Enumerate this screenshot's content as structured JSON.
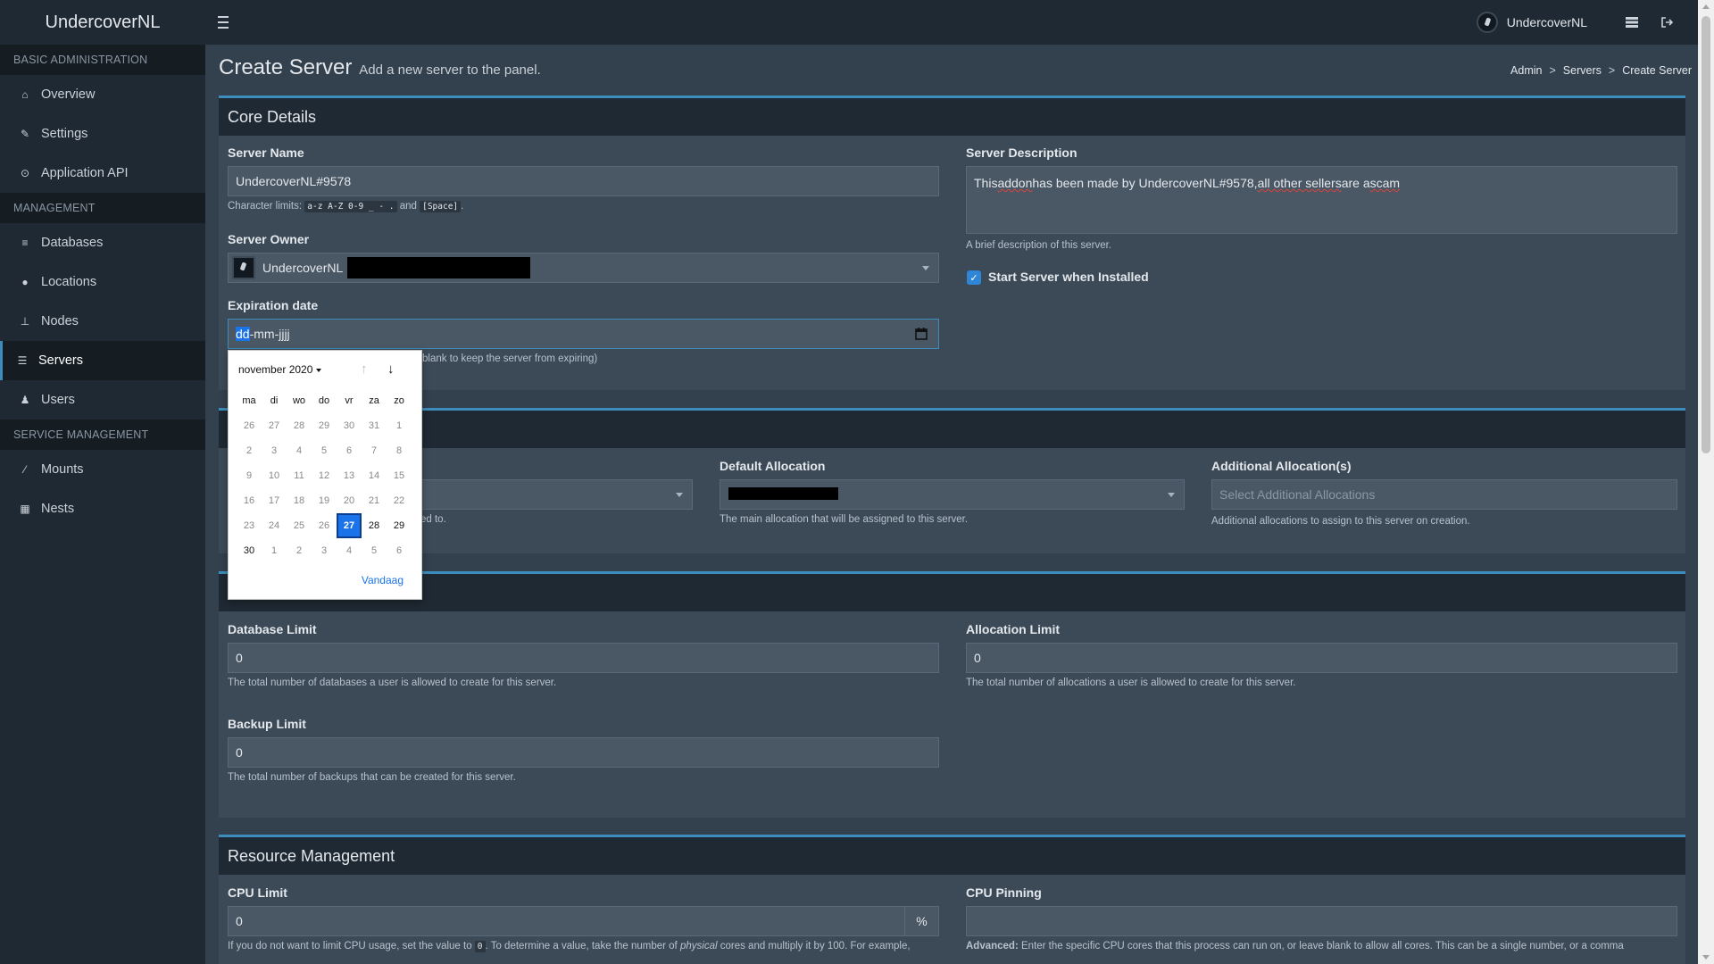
{
  "header": {
    "brand": "UndercoverNL",
    "user_name": "UndercoverNL"
  },
  "sidebar": {
    "sections": [
      {
        "title": "BASIC ADMINISTRATION",
        "items": [
          {
            "label": "Overview",
            "icon": "home-icon"
          },
          {
            "label": "Settings",
            "icon": "wrench-icon"
          },
          {
            "label": "Application API",
            "icon": "gamepad-icon"
          }
        ]
      },
      {
        "title": "MANAGEMENT",
        "items": [
          {
            "label": "Databases",
            "icon": "database-icon"
          },
          {
            "label": "Locations",
            "icon": "globe-icon"
          },
          {
            "label": "Nodes",
            "icon": "sitemap-icon"
          },
          {
            "label": "Servers",
            "icon": "server-icon",
            "active": true
          },
          {
            "label": "Users",
            "icon": "users-icon"
          }
        ]
      },
      {
        "title": "SERVICE MANAGEMENT",
        "items": [
          {
            "label": "Mounts",
            "icon": "magic-icon"
          },
          {
            "label": "Nests",
            "icon": "th-large-icon"
          }
        ]
      }
    ]
  },
  "page": {
    "title": "Create Server",
    "subtitle": "Add a new server to the panel.",
    "breadcrumb": [
      "Admin",
      "Servers",
      "Create Server"
    ]
  },
  "core": {
    "title": "Core Details",
    "server_name_label": "Server Name",
    "server_name_value": "UndercoverNL#9578",
    "char_limits_prefix": "Character limits:",
    "char_limits_code1": "a-z A-Z 0-9 _ - .",
    "char_limits_and": "and",
    "char_limits_code2": "[Space]",
    "char_limits_suffix": ".",
    "owner_label": "Server Owner",
    "owner_value": "UndercoverNL",
    "expiration_label": "Expiration date",
    "expiration_dd": "dd",
    "expiration_rest": "-mm-jjjj",
    "expiration_help": "blank to keep the server from expiring)",
    "description_label": "Server Description",
    "description_value_pre": "This ",
    "description_w1": "addon",
    "description_mid": " has been made by UndercoverNL#9578, ",
    "description_w2": "all other sellers",
    "description_post": " are a ",
    "description_w3": "scam",
    "description_help": "A brief description of this server.",
    "start_label": "Start Server when Installed",
    "start_checked": true
  },
  "allocation": {
    "node_help": "ed to.",
    "default_label": "Default Allocation",
    "default_help": "The main allocation that will be assigned to this server.",
    "additional_label": "Additional Allocation(s)",
    "additional_placeholder": "Select Additional Allocations",
    "additional_help": "Additional allocations to assign to this server on creation."
  },
  "limits": {
    "db_label": "Database Limit",
    "db_value": "0",
    "db_help": "The total number of databases a user is allowed to create for this server.",
    "alloc_label": "Allocation Limit",
    "alloc_value": "0",
    "alloc_help": "The total number of allocations a user is allowed to create for this server.",
    "backup_label": "Backup Limit",
    "backup_value": "0",
    "backup_help": "The total number of backups that can be created for this server."
  },
  "resources": {
    "title": "Resource Management",
    "cpu_label": "CPU Limit",
    "cpu_value": "0",
    "cpu_unit": "%",
    "cpu_help_a": "If you do not want to limit CPU usage, set the value to",
    "cpu_help_code": "0",
    "cpu_help_b": ". To determine a value, take the number of",
    "cpu_help_em": "physical",
    "cpu_help_c": "cores and multiply it by 100. For example,",
    "pin_label": "CPU Pinning",
    "pin_help_strong": "Advanced:",
    "pin_help": "Enter the specific CPU cores that this process can run on, or leave blank to allow all cores. This can be a single number, or a comma"
  },
  "datepicker": {
    "month_label": "november 2020",
    "weekdays": [
      "ma",
      "di",
      "wo",
      "do",
      "vr",
      "za",
      "zo"
    ],
    "days": [
      [
        "26",
        "27",
        "28",
        "29",
        "30",
        "31",
        "1"
      ],
      [
        "2",
        "3",
        "4",
        "5",
        "6",
        "7",
        "8"
      ],
      [
        "9",
        "10",
        "11",
        "12",
        "13",
        "14",
        "15"
      ],
      [
        "16",
        "17",
        "18",
        "19",
        "20",
        "21",
        "22"
      ],
      [
        "23",
        "24",
        "25",
        "26",
        "27",
        "28",
        "29"
      ],
      [
        "30",
        "1",
        "2",
        "3",
        "4",
        "5",
        "6"
      ]
    ],
    "selected": "27",
    "today_label": "Vandaag"
  },
  "colors": {
    "accent": "#3c8dbc",
    "sidebar_bg": "#1f2933",
    "content_bg": "#33404d",
    "box_bg": "#3c4a57"
  }
}
